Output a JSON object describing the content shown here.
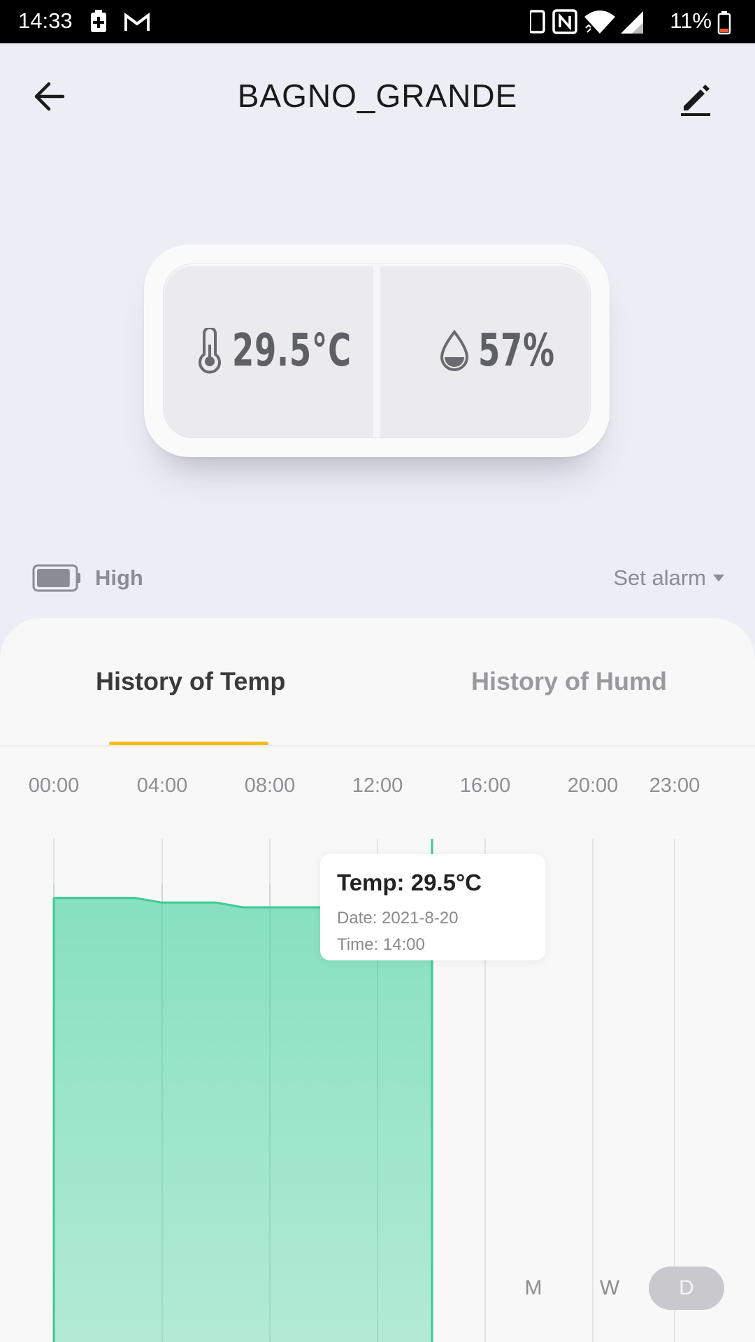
{
  "status_bar": {
    "time": "14:33",
    "battery_percent": "11%",
    "icons": [
      "battery-saver-icon",
      "gmail-icon",
      "phone-icon",
      "nfc-icon",
      "wifi-icon",
      "signal-icon",
      "battery-icon"
    ]
  },
  "header": {
    "title": "BAGNO_GRANDE",
    "back_icon": "arrow-left-icon",
    "edit_icon": "pencil-icon"
  },
  "device": {
    "temperature": "29.5°C",
    "humidity": "57%"
  },
  "battery": {
    "label": "High",
    "level": 0.9
  },
  "alarm": {
    "label": "Set alarm"
  },
  "tabs": [
    {
      "label": "History of Temp",
      "active": true
    },
    {
      "label": "History of Humd",
      "active": false
    }
  ],
  "tooltip": {
    "title": "Temp: 29.5°C",
    "date": "Date: 2021-8-20",
    "time": "Time: 14:00"
  },
  "chart_data": {
    "type": "area",
    "x_ticks": [
      "00:00",
      "04:00",
      "08:00",
      "12:00",
      "16:00",
      "20:00",
      "23:00"
    ],
    "x": [
      0,
      1,
      2,
      3,
      4,
      5,
      6,
      7,
      8,
      9,
      10,
      11,
      12,
      13,
      14
    ],
    "values": [
      29.4,
      29.4,
      29.4,
      29.4,
      29.3,
      29.3,
      29.3,
      29.2,
      29.2,
      29.2,
      29.2,
      29.2,
      29.2,
      29.4,
      29.5
    ],
    "selected_x": 14,
    "color": "#3ec995"
  },
  "ranges": [
    {
      "label": "M",
      "active": false
    },
    {
      "label": "W",
      "active": false
    },
    {
      "label": "D",
      "active": true
    }
  ]
}
